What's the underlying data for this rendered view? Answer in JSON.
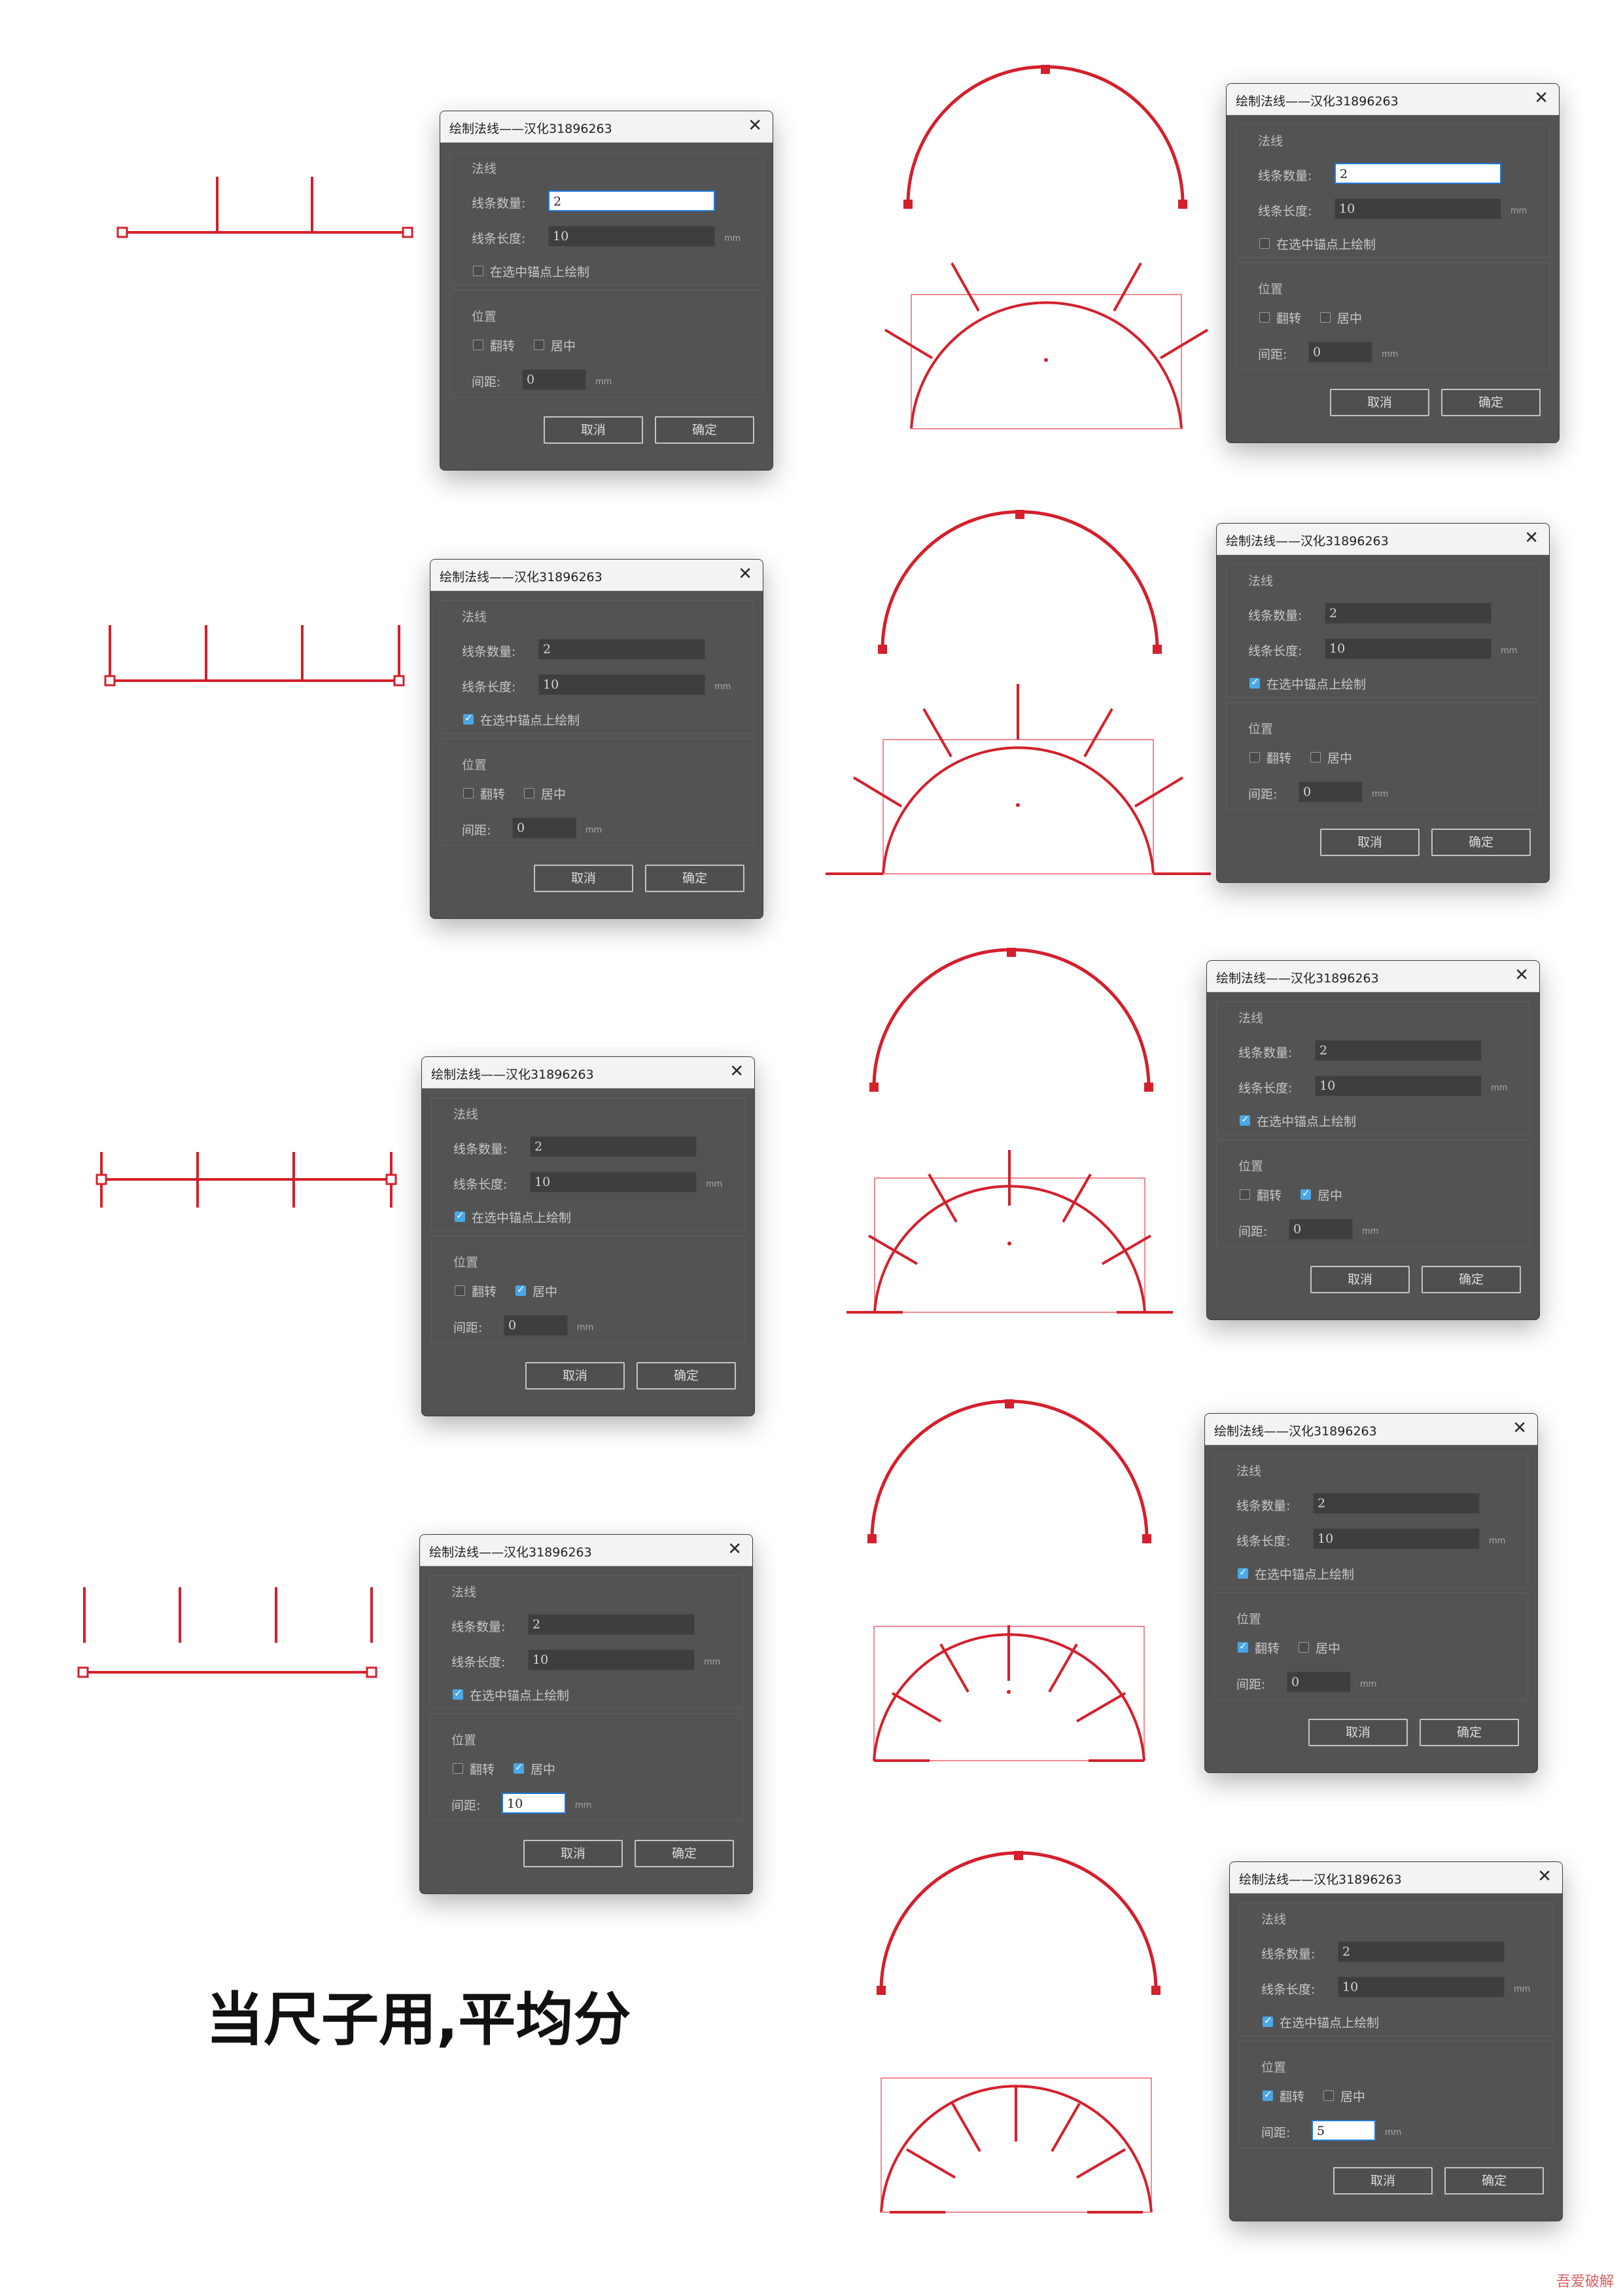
{
  "dialog": {
    "title": "绘制法线——汉化31896263",
    "close_glyph": "✕",
    "group_normals": "法线",
    "count_label": "线条数量:",
    "length_label": "线条长度:",
    "unit": "mm",
    "anchor_label": "在选中锚点上绘制",
    "group_position": "位置",
    "flip_label": "翻转",
    "center_label": "居中",
    "spacing_label": "间距:",
    "cancel_label": "取消",
    "ok_label": "确定"
  },
  "examples": [
    {
      "id": "left-1",
      "count": "2",
      "length": "10",
      "spacing": "0",
      "anchor": false,
      "flip": false,
      "center": false,
      "active_field": "count"
    },
    {
      "id": "left-2",
      "count": "2",
      "length": "10",
      "spacing": "0",
      "anchor": true,
      "flip": false,
      "center": false,
      "active_field": ""
    },
    {
      "id": "left-3",
      "count": "2",
      "length": "10",
      "spacing": "0",
      "anchor": true,
      "flip": false,
      "center": true,
      "active_field": ""
    },
    {
      "id": "left-4",
      "count": "2",
      "length": "10",
      "spacing": "10",
      "anchor": true,
      "flip": false,
      "center": true,
      "active_field": "spacing"
    },
    {
      "id": "right-1",
      "count": "2",
      "length": "10",
      "spacing": "0",
      "anchor": false,
      "flip": false,
      "center": false,
      "active_field": "count"
    },
    {
      "id": "right-2",
      "count": "2",
      "length": "10",
      "spacing": "0",
      "anchor": true,
      "flip": false,
      "center": false,
      "active_field": ""
    },
    {
      "id": "right-3",
      "count": "2",
      "length": "10",
      "spacing": "0",
      "anchor": true,
      "flip": false,
      "center": true,
      "active_field": ""
    },
    {
      "id": "right-4",
      "count": "2",
      "length": "10",
      "spacing": "0",
      "anchor": true,
      "flip": true,
      "center": false,
      "active_field": ""
    },
    {
      "id": "right-5",
      "count": "2",
      "length": "10",
      "spacing": "5",
      "anchor": true,
      "flip": true,
      "center": false,
      "active_field": "spacing"
    }
  ],
  "caption": "当尺子用,平均分",
  "watermark": "吾爱破解",
  "colors": {
    "accent_red": "#d4202c",
    "dialog_bg": "#535353",
    "checkbox_on": "#4aa8e8"
  }
}
